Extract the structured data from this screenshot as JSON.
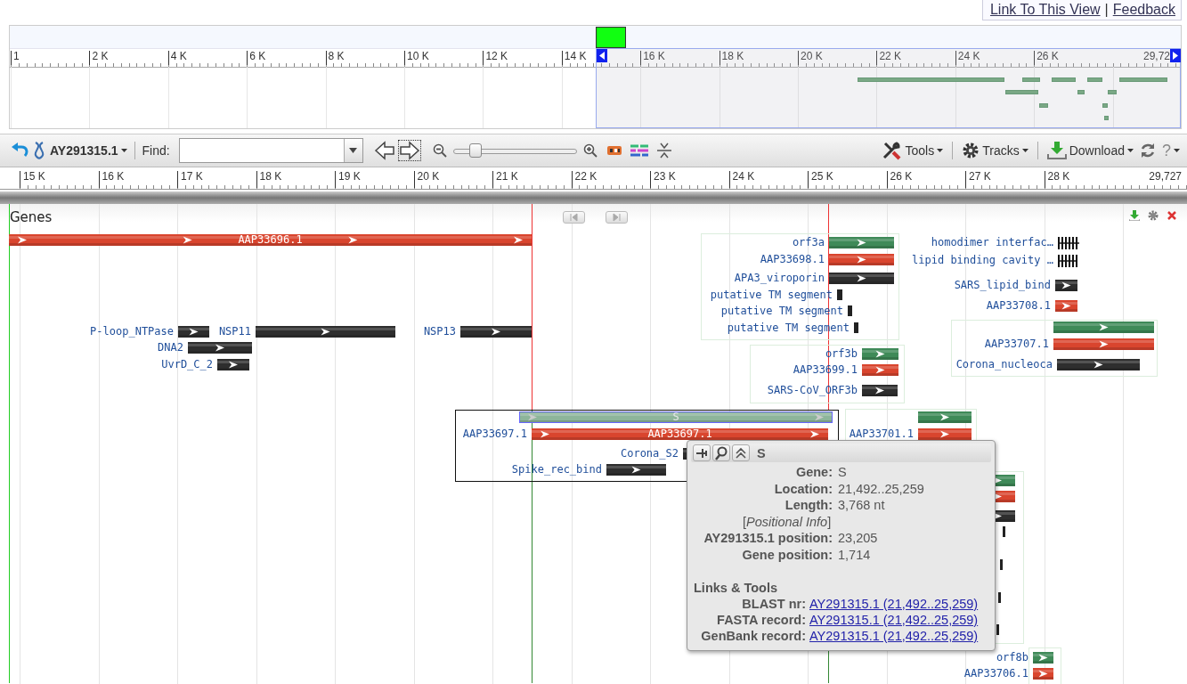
{
  "header_links": {
    "links": [
      {
        "label": "Link To This View"
      },
      {
        "label": "Feedback"
      }
    ],
    "separator": "|"
  },
  "overview": {
    "ticks": [
      "1",
      "2 K",
      "4 K",
      "6 K",
      "8 K",
      "10 K",
      "12 K",
      "14 K",
      "16 K",
      "18 K",
      "20 K",
      "22 K",
      "24 K",
      "26 K"
    ],
    "end_label": "29,72"
  },
  "toolbar": {
    "sequence": "AY291315.1",
    "find_label": "Find:",
    "zoom": {
      "level": 0.15
    },
    "menus": [
      {
        "label": "Tools"
      },
      {
        "label": "Tracks"
      },
      {
        "label": "Download"
      }
    ],
    "help": "?"
  },
  "ruler": {
    "ticks": [
      "15 K",
      "16 K",
      "17 K",
      "18 K",
      "19 K",
      "20 K",
      "21 K",
      "22 K",
      "23 K",
      "24 K",
      "25 K",
      "26 K",
      "27 K",
      "28 K"
    ],
    "end_label": "29,727"
  },
  "track": {
    "title": "Genes",
    "features": [
      {
        "inner_label": "AAP33696.1",
        "kind": "mrna",
        "selected": false
      },
      {
        "label": "orf3a",
        "kind": "gene",
        "selected": false
      },
      {
        "label": "AAP33698.1",
        "kind": "mrna",
        "selected": false
      },
      {
        "label": "APA3_viroporin",
        "kind": "domain",
        "selected": false
      },
      {
        "label": "putative TM segment",
        "kind": "site",
        "selected": false
      },
      {
        "label": "putative TM segment",
        "kind": "site",
        "selected": false
      },
      {
        "label": "putative TM segment",
        "kind": "site",
        "selected": false
      },
      {
        "label": "homodimer interfac…",
        "kind": "motif",
        "selected": false
      },
      {
        "label": "lipid binding cavity …",
        "kind": "motif",
        "selected": false
      },
      {
        "label": "SARS_lipid_bind",
        "kind": "domain",
        "selected": false
      },
      {
        "label": "AAP33708.1",
        "kind": "mrna",
        "selected": false
      },
      {
        "kind": "gene",
        "selected": false
      },
      {
        "label": "AAP33707.1",
        "kind": "mrna",
        "selected": false
      },
      {
        "label": "Corona_nucleoca",
        "kind": "domain",
        "selected": false
      },
      {
        "label": "P-loop_NTPase",
        "kind": "domain",
        "selected": false
      },
      {
        "label": "NSP11",
        "kind": "domain",
        "selected": false
      },
      {
        "label": "NSP13",
        "kind": "domain",
        "selected": false
      },
      {
        "label": "DNA2",
        "kind": "domain",
        "selected": false
      },
      {
        "label": "UvrD_C_2",
        "kind": "domain",
        "selected": false
      },
      {
        "label": "orf3b",
        "kind": "gene",
        "selected": false
      },
      {
        "label": "AAP33699.1",
        "kind": "mrna",
        "selected": false
      },
      {
        "label": "SARS-CoV_ORF3b",
        "kind": "domain",
        "selected": false
      },
      {
        "inner_label": "S",
        "kind": "gene",
        "selected": true
      },
      {
        "label": "AAP33697.1",
        "inner_label": "AAP33697.1",
        "kind": "mrna",
        "selected": false
      },
      {
        "label": "Corona_S2",
        "kind": "domain",
        "selected": false
      },
      {
        "label": "Spike_rec_bind",
        "kind": "domain",
        "selected": false
      },
      {
        "kind": "gene",
        "selected": false
      },
      {
        "label": "AAP33701.1",
        "kind": "mrna",
        "selected": false
      },
      {
        "kind": "gene",
        "selected": false
      },
      {
        "kind": "mrna",
        "selected": false
      },
      {
        "kind": "domain",
        "selected": false
      },
      {
        "kind": "site",
        "selected": false
      },
      {
        "kind": "site",
        "selected": false
      },
      {
        "kind": "site",
        "selected": false
      },
      {
        "kind": "site",
        "selected": false
      },
      {
        "label": "orf8b",
        "kind": "gene",
        "selected": false
      },
      {
        "label": "AAP33706.1",
        "kind": "mrna",
        "selected": false
      }
    ]
  },
  "popup": {
    "title": "S",
    "fields": [
      {
        "label": "Gene:",
        "value": "S"
      },
      {
        "label": "Location:",
        "value": "21,492..25,259"
      },
      {
        "label": "Length:",
        "value": "3,768 nt"
      }
    ],
    "note": "[*Positional Info*]",
    "position_fields": [
      {
        "label": "AY291315.1 position:",
        "value": "23,205"
      },
      {
        "label": "Gene position:",
        "value": "1,714"
      }
    ],
    "links_heading": "Links & Tools",
    "links": [
      {
        "label": "BLAST nr:",
        "value": "AY291315.1 (21,492..25,259)"
      },
      {
        "label": "FASTA record:",
        "value": "AY291315.1 (21,492..25,259)"
      },
      {
        "label": "GenBank record:",
        "value": "AY291315.1 (21,492..25,259)"
      }
    ]
  }
}
